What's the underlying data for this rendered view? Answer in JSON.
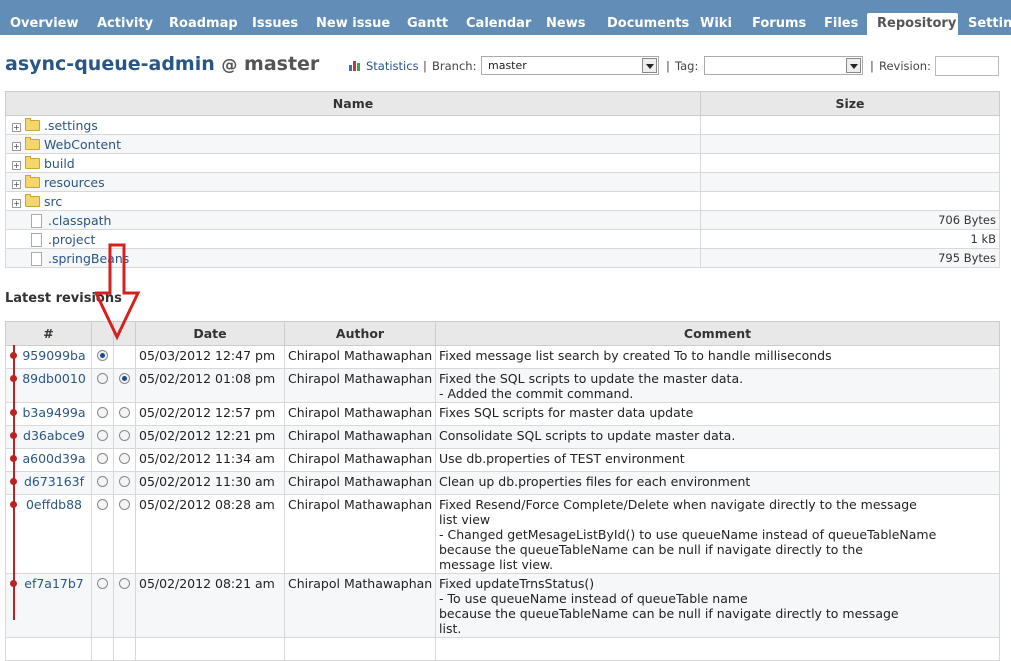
{
  "tabs": [
    "Overview",
    "Activity",
    "Roadmap",
    "Issues",
    "New issue",
    "Gantt",
    "Calendar",
    "News",
    "Documents",
    "Wiki",
    "Forums",
    "Files",
    "Repository",
    "Settings"
  ],
  "title": {
    "project": "async-queue-admin",
    "at": "@",
    "branch": "master"
  },
  "toolbar": {
    "statistics": "Statistics",
    "sep1": "|",
    "branch_label": "Branch:",
    "branch_value": "master",
    "sep2": "|",
    "tag_label": "Tag:",
    "tag_value": "",
    "sep3": "|",
    "revision_label": "Revision:",
    "revision_value": ""
  },
  "files": {
    "headers": {
      "name": "Name",
      "size": "Size"
    },
    "rows": [
      {
        "name": ".settings",
        "type": "folder",
        "size": ""
      },
      {
        "name": "WebContent",
        "type": "folder",
        "size": ""
      },
      {
        "name": "build",
        "type": "folder",
        "size": ""
      },
      {
        "name": "resources",
        "type": "folder",
        "size": ""
      },
      {
        "name": "src",
        "type": "folder",
        "size": ""
      },
      {
        "name": ".classpath",
        "type": "file",
        "size": "706 Bytes"
      },
      {
        "name": ".project",
        "type": "file",
        "size": "1 kB"
      },
      {
        "name": ".springBeans",
        "type": "file",
        "size": "795 Bytes"
      }
    ]
  },
  "revisions": {
    "title": "Latest revisions",
    "headers": {
      "rev": "#",
      "date": "Date",
      "author": "Author",
      "comment": "Comment"
    },
    "rows": [
      {
        "rev": "959099ba",
        "date": "05/03/2012 12:47 pm",
        "author": "Chirapol Mathawaphan",
        "comment": "Fixed message list search by created To to handle milliseconds",
        "r1": true,
        "r2": null
      },
      {
        "rev": "89db0010",
        "date": "05/02/2012 01:08 pm",
        "author": "Chirapol Mathawaphan",
        "comment": "Fixed the SQL scripts to update the master data.\n- Added the commit command.",
        "r1": false,
        "r2": true
      },
      {
        "rev": "b3a9499a",
        "date": "05/02/2012 12:57 pm",
        "author": "Chirapol Mathawaphan",
        "comment": "Fixes SQL scripts for master data update",
        "r1": false,
        "r2": false
      },
      {
        "rev": "d36abce9",
        "date": "05/02/2012 12:21 pm",
        "author": "Chirapol Mathawaphan",
        "comment": "Consolidate SQL scripts to update master data.",
        "r1": false,
        "r2": false
      },
      {
        "rev": "a600d39a",
        "date": "05/02/2012 11:34 am",
        "author": "Chirapol Mathawaphan",
        "comment": "Use db.properties of TEST environment",
        "r1": false,
        "r2": false
      },
      {
        "rev": "d673163f",
        "date": "05/02/2012 11:30 am",
        "author": "Chirapol Mathawaphan",
        "comment": "Clean up db.properties files for each environment",
        "r1": false,
        "r2": false
      },
      {
        "rev": "0effdb88",
        "date": "05/02/2012 08:28 am",
        "author": "Chirapol Mathawaphan",
        "comment": "Fixed Resend/Force Complete/Delete when navigate directly to the message\nlist view\n- Changed getMesageListById() to use queueName instead of queueTableName\nbecause the queueTableName can be null if navigate directly to the\nmessage list view.",
        "r1": false,
        "r2": false
      },
      {
        "rev": "ef7a17b7",
        "date": "05/02/2012 08:21 am",
        "author": "Chirapol Mathawaphan",
        "comment": "Fixed updateTrnsStatus()\n- To use queueName instead of queueTable name\nbecause the queueTableName can be null if navigate directly to message\nlist.",
        "r1": false,
        "r2": false
      },
      {
        "rev": "",
        "date": "",
        "author": "",
        "comment": "",
        "r1": false,
        "r2": false
      }
    ]
  },
  "colors": {
    "tabbar": "#628db6",
    "link": "#2a5685",
    "graph": "#b22222",
    "annotation_arrow": "#d42020"
  }
}
